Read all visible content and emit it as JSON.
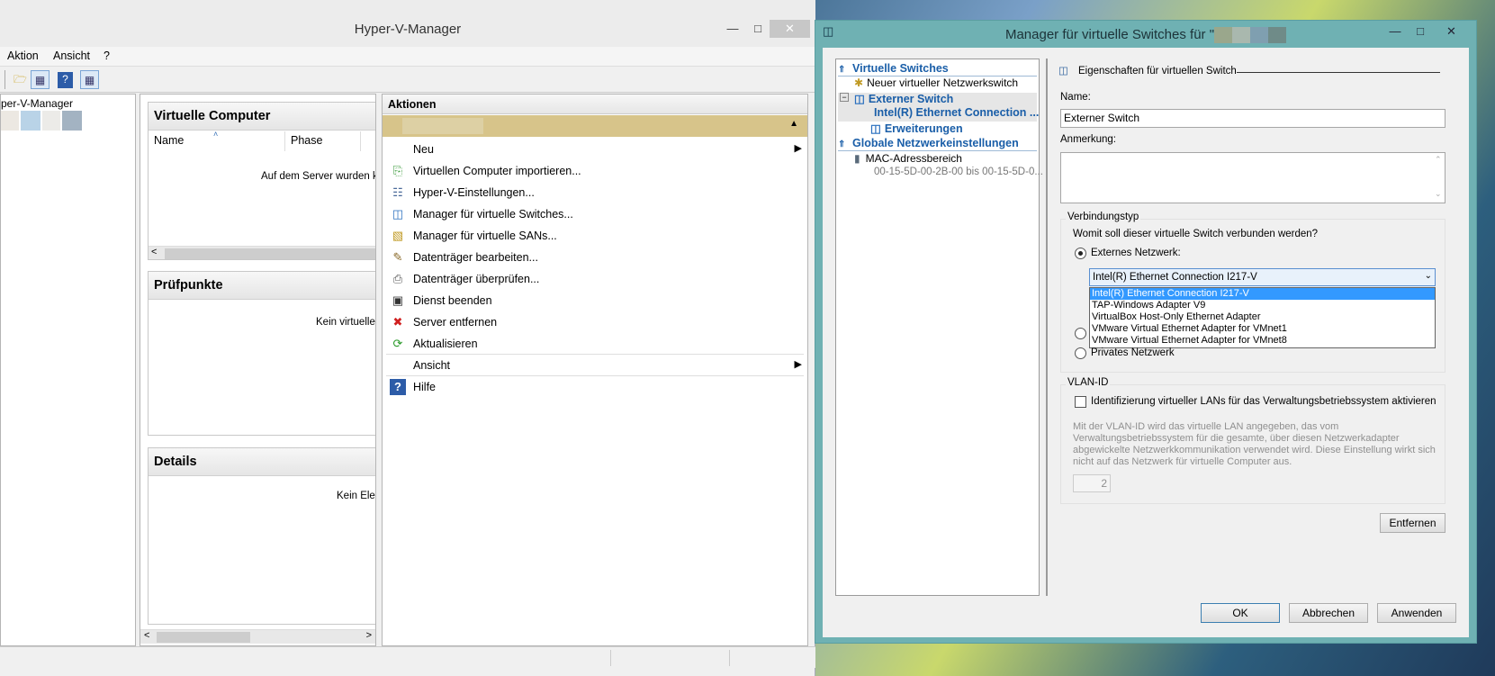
{
  "hyperv": {
    "title": "Hyper-V-Manager",
    "menu": [
      "Aktion",
      "Ansicht",
      "?"
    ],
    "tree_root": "per-V-Manager",
    "vm_pane": {
      "title": "Virtuelle Computer",
      "col_name": "Name",
      "col_phase": "Phase",
      "message": "Auf dem Server wurden ke"
    },
    "checkpoint_pane": {
      "title": "Prüfpunkte",
      "message": "Kein virtueller"
    },
    "details_pane": {
      "title": "Details",
      "message": "Kein Eler"
    },
    "actions": {
      "header": "Aktionen",
      "items": [
        {
          "label": "Neu",
          "icon": "none",
          "submenu": true
        },
        {
          "label": "Virtuellen Computer importieren...",
          "icon": "import-icon"
        },
        {
          "label": "Hyper-V-Einstellungen...",
          "icon": "settings-icon"
        },
        {
          "label": "Manager für virtuelle Switches...",
          "icon": "switch-icon"
        },
        {
          "label": "Manager für virtuelle SANs...",
          "icon": "san-icon"
        },
        {
          "label": "Datenträger bearbeiten...",
          "icon": "edit-disk-icon"
        },
        {
          "label": "Datenträger überprüfen...",
          "icon": "inspect-disk-icon"
        },
        {
          "label": "Dienst beenden",
          "icon": "stop-icon"
        },
        {
          "label": "Server entfernen",
          "icon": "remove-icon"
        },
        {
          "label": "Aktualisieren",
          "icon": "refresh-icon"
        },
        {
          "label": "Ansicht",
          "icon": "none",
          "submenu": true
        },
        {
          "label": "Hilfe",
          "icon": "help-icon"
        }
      ]
    }
  },
  "vswitch": {
    "title": "Manager für virtuelle Switches für \"",
    "title_suffix": "",
    "tree": {
      "section_switches": "Virtuelle Switches",
      "new_switch": "Neuer virtueller Netzwerkswitch",
      "external_switch": "Externer Switch",
      "external_adapter": "Intel(R) Ethernet Connection ...",
      "extensions": "Erweiterungen",
      "section_global": "Globale Netzwerkeinstellungen",
      "mac_range": "MAC-Adressbereich",
      "mac_value": "00-15-5D-00-2B-00 bis 00-15-5D-0..."
    },
    "props": {
      "header": "Eigenschaften für virtuellen Switch",
      "name_label": "Name:",
      "name_value": "Externer Switch",
      "notes_label": "Anmerkung:",
      "notes_value": "",
      "conn_group": "Verbindungstyp",
      "conn_question": "Womit soll dieser virtuelle Switch verbunden werden?",
      "external_network": "Externes Netzwerk:",
      "adapter_selected": "Intel(R) Ethernet Connection I217-V",
      "adapter_options": [
        "Intel(R) Ethernet Connection I217-V",
        "TAP-Windows Adapter V9",
        "VirtualBox Host-Only Ethernet Adapter",
        "VMware Virtual Ethernet Adapter for VMnet1",
        "VMware Virtual Ethernet Adapter for VMnet8"
      ],
      "private_network": "Privates Netzwerk",
      "vlan_group": "VLAN-ID",
      "vlan_check": "Identifizierung virtueller LANs für das Verwaltungsbetriebssystem aktivieren",
      "vlan_desc": "Mit der VLAN-ID wird das virtuelle LAN angegeben, das vom Verwaltungsbetriebssystem für die gesamte, über diesen Netzwerkadapter abgewickelte Netzwerkkommunikation verwendet wird. Diese Einstellung wirkt sich nicht auf das Netzwerk für virtuelle Computer aus.",
      "vlan_value": "2",
      "remove_button": "Entfernen"
    },
    "buttons": {
      "ok": "OK",
      "cancel": "Abbrechen",
      "apply": "Anwenden"
    }
  }
}
